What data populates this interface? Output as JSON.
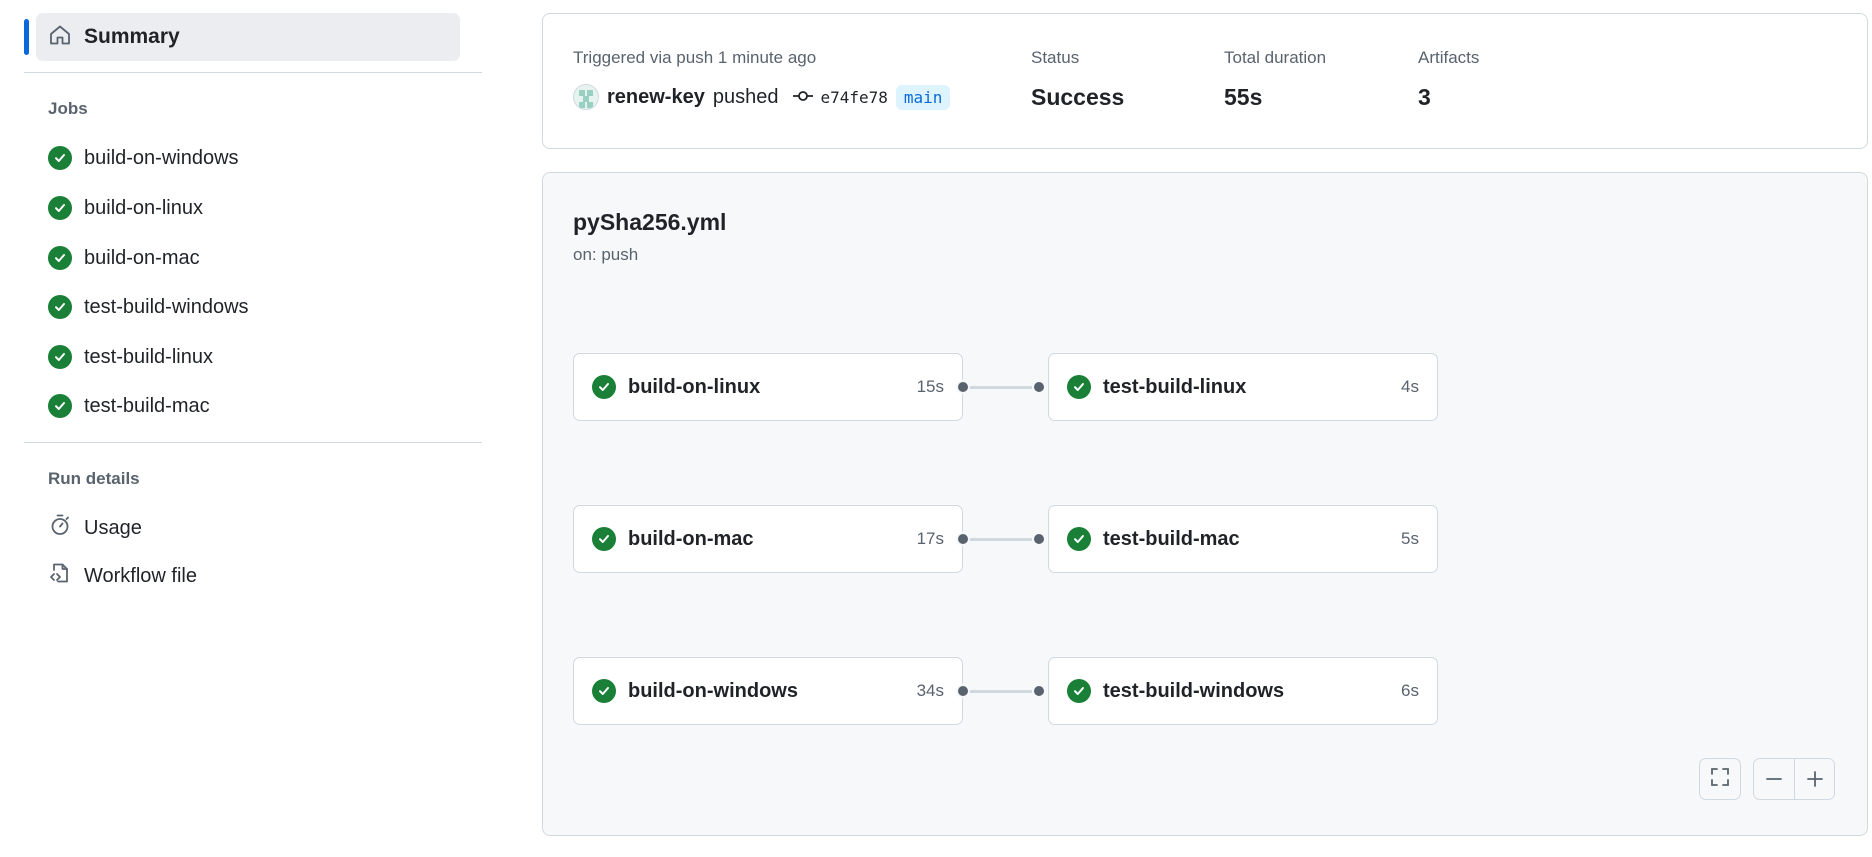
{
  "sidebar": {
    "summary_label": "Summary",
    "jobs_title": "Jobs",
    "jobs": [
      {
        "label": "build-on-windows"
      },
      {
        "label": "build-on-linux"
      },
      {
        "label": "build-on-mac"
      },
      {
        "label": "test-build-windows"
      },
      {
        "label": "test-build-linux"
      },
      {
        "label": "test-build-mac"
      }
    ],
    "run_details_title": "Run details",
    "usage_label": "Usage",
    "workflow_file_label": "Workflow file"
  },
  "summary": {
    "trigger_text": "Triggered via push 1 minute ago",
    "actor": "renew-key",
    "verb": "pushed",
    "commit": "e74fe78",
    "branch": "main",
    "status_label": "Status",
    "status_value": "Success",
    "duration_label": "Total duration",
    "duration_value": "55s",
    "artifacts_label": "Artifacts",
    "artifacts_value": "3"
  },
  "graph": {
    "title": "pySha256.yml",
    "subtitle": "on: push",
    "rows": [
      {
        "build": {
          "name": "build-on-linux",
          "duration": "15s"
        },
        "test": {
          "name": "test-build-linux",
          "duration": "4s"
        }
      },
      {
        "build": {
          "name": "build-on-mac",
          "duration": "17s"
        },
        "test": {
          "name": "test-build-mac",
          "duration": "5s"
        }
      },
      {
        "build": {
          "name": "build-on-windows",
          "duration": "34s"
        },
        "test": {
          "name": "test-build-windows",
          "duration": "6s"
        }
      }
    ]
  },
  "colors": {
    "success": "#1a7f37",
    "accent": "#0969da",
    "branch_bg": "#ddf4ff"
  }
}
